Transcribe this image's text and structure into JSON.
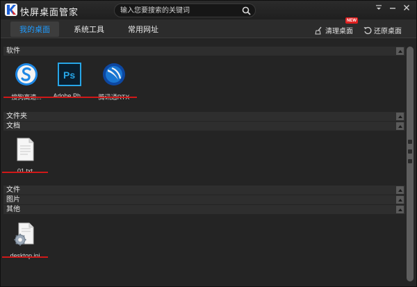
{
  "app": {
    "title": "快屏桌面管家"
  },
  "search": {
    "placeholder": "输入您要搜索的关键词"
  },
  "tabs": [
    {
      "label": "我的桌面",
      "active": true
    },
    {
      "label": "系统工具",
      "active": false
    },
    {
      "label": "常用网址",
      "active": false
    }
  ],
  "actions": {
    "clean_label": "清理桌面",
    "restore_label": "还原桌面",
    "new_badge": "NEW"
  },
  "sections": {
    "software": "软件",
    "folders": "文件夹",
    "documents": "文档",
    "files": "文件",
    "pictures": "图片",
    "other": "其他"
  },
  "items": {
    "software": [
      {
        "label": "搜狗高速...",
        "icon": "sogou-icon"
      },
      {
        "label": "Adobe Ph...",
        "icon": "photoshop-icon"
      },
      {
        "label": "腾讯通RTX",
        "icon": "rtx-icon"
      }
    ],
    "documents": [
      {
        "label": "01.txt",
        "icon": "text-file-icon"
      }
    ],
    "other": [
      {
        "label": "desktop.ini",
        "icon": "ini-file-icon"
      }
    ]
  },
  "colors": {
    "accent": "#1e9bff",
    "strike": "#d01818",
    "badge": "#e02020"
  }
}
